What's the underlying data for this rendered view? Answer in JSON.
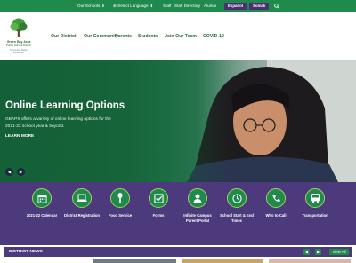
{
  "topbar": {
    "our_schools": "Our Schools",
    "select_language": "Select Language",
    "staff": "Staff",
    "staff_directory": "Staff Directory",
    "alumni": "Alumni",
    "espanol": "Español",
    "somali": "Somali"
  },
  "logo": {
    "line1": "Green Bay Area",
    "line2": "Public School District",
    "line3": "Community. Belief. Excellence."
  },
  "nav": {
    "items": [
      "Our District",
      "Our Community",
      "Parents",
      "Students",
      "Join Our Team",
      "COVID-19"
    ]
  },
  "hero": {
    "title": "Online Learning Options",
    "text": "GBAPS offers a variety of online learning options for the 2021-22 school year & beyond.",
    "more": "LEARN MORE",
    "prev": "◀",
    "next": "▶"
  },
  "quick_links": [
    {
      "label": "2021-22 Calendar",
      "icon": "calendar-icon"
    },
    {
      "label": "District Registration",
      "icon": "laptop-icon"
    },
    {
      "label": "Food Service",
      "icon": "fork-icon"
    },
    {
      "label": "Forms",
      "icon": "checkbox-icon"
    },
    {
      "label": "Infinite Campus Parent Portal",
      "icon": "person-icon"
    },
    {
      "label": "School Start & End Times",
      "icon": "clock-icon"
    },
    {
      "label": "Who to Call",
      "icon": "phone-icon"
    },
    {
      "label": "Transportation",
      "icon": "bus-icon"
    }
  ],
  "news": {
    "title": "DISTRICT NEWS",
    "prev": "◀",
    "next": "▶",
    "view_all": "View All"
  },
  "colors": {
    "green": "#1f8a4c",
    "purple": "#4c3a7c",
    "lime": "#9fd45a"
  }
}
